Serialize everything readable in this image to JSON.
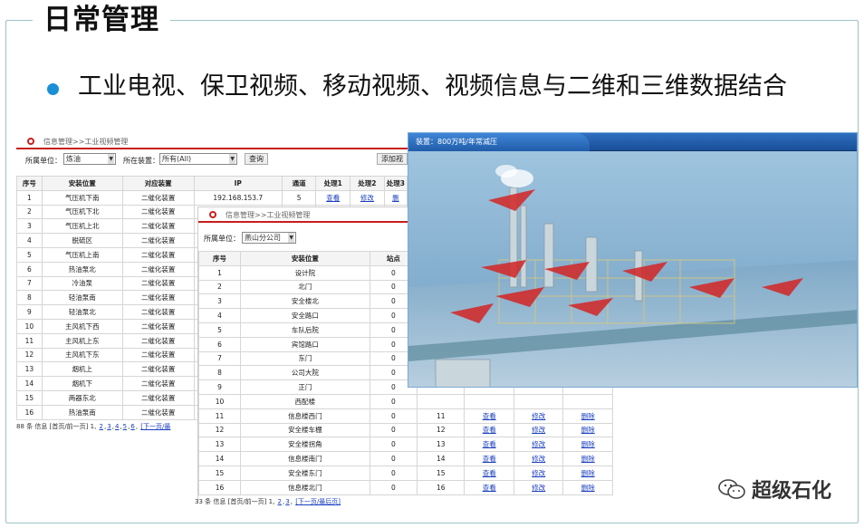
{
  "slide": {
    "title": "日常管理",
    "bullet_text": "工业电视、保卫视频、移动视频、视频信息与二维和三维数据结合"
  },
  "sheet1": {
    "breadcrumb": "信息管理>>工业视频管理",
    "filter_unit_label": "所属单位：",
    "filter_unit_value": "炼油",
    "filter_device_label": "所在装置：",
    "filter_device_value": "所有(All)",
    "query_button": "查询",
    "add_button": "添加视频",
    "columns": [
      "序号",
      "安装位置",
      "对应装置",
      "IP",
      "通道",
      "处理1",
      "处理2",
      "处理3"
    ],
    "ip_value": "192.168.153.7",
    "channel_value": "5",
    "action_view": "查看",
    "action_edit": "修改",
    "action_delete": "删",
    "rows": [
      {
        "no": "1",
        "loc": "气压机下南",
        "dev": "二催化装置"
      },
      {
        "no": "2",
        "loc": "气压机下北",
        "dev": "二催化装置"
      },
      {
        "no": "3",
        "loc": "气压机上北",
        "dev": "二催化装置"
      },
      {
        "no": "4",
        "loc": "脱硫区",
        "dev": "二催化装置"
      },
      {
        "no": "5",
        "loc": "气压机上南",
        "dev": "二催化装置"
      },
      {
        "no": "6",
        "loc": "热油泵北",
        "dev": "二催化装置"
      },
      {
        "no": "7",
        "loc": "冷油泵",
        "dev": "二催化装置"
      },
      {
        "no": "8",
        "loc": "轻油泵南",
        "dev": "二催化装置"
      },
      {
        "no": "9",
        "loc": "轻油泵北",
        "dev": "二催化装置"
      },
      {
        "no": "10",
        "loc": "主风机下西",
        "dev": "二催化装置"
      },
      {
        "no": "11",
        "loc": "主风机上东",
        "dev": "二催化装置"
      },
      {
        "no": "12",
        "loc": "主风机下东",
        "dev": "二催化装置"
      },
      {
        "no": "13",
        "loc": "烟机上",
        "dev": "二催化装置"
      },
      {
        "no": "14",
        "loc": "烟机下",
        "dev": "二催化装置"
      },
      {
        "no": "15",
        "loc": "两器东北",
        "dev": "二催化装置"
      },
      {
        "no": "16",
        "loc": "热油泵南",
        "dev": "二催化装置"
      }
    ],
    "pager_prefix": "88 条 信息 [首页/前一页] 1,",
    "pager_pages": [
      "2",
      "3",
      "4",
      "5",
      "6"
    ],
    "pager_next": "[下一页/最"
  },
  "sheet2": {
    "breadcrumb": "信息管理>>工业视频管理",
    "filter_unit_label": "所属单位：",
    "filter_unit_value": "燕山分公司",
    "columns": [
      "序号",
      "安装位置",
      "站点"
    ],
    "action_view": "查看",
    "action_edit": "修改",
    "action_delete": "删除",
    "rows": [
      {
        "no": "1",
        "loc": "设计院",
        "site": "0"
      },
      {
        "no": "2",
        "loc": "北门",
        "site": "0"
      },
      {
        "no": "3",
        "loc": "安全楼北",
        "site": "0"
      },
      {
        "no": "4",
        "loc": "安全路口",
        "site": "0"
      },
      {
        "no": "5",
        "loc": "车队后院",
        "site": "0"
      },
      {
        "no": "6",
        "loc": "宾馆路口",
        "site": "0"
      },
      {
        "no": "7",
        "loc": "东门",
        "site": "0"
      },
      {
        "no": "8",
        "loc": "公司大院",
        "site": "0"
      },
      {
        "no": "9",
        "loc": "正门",
        "site": "0"
      },
      {
        "no": "10",
        "loc": "西配楼",
        "site": "0"
      },
      {
        "no": "11",
        "loc": "信息楼西门",
        "site": "0",
        "ch": "11"
      },
      {
        "no": "12",
        "loc": "安全楼车棚",
        "site": "0",
        "ch": "12"
      },
      {
        "no": "13",
        "loc": "安全楼拐角",
        "site": "0",
        "ch": "13"
      },
      {
        "no": "14",
        "loc": "信息楼南门",
        "site": "0",
        "ch": "14"
      },
      {
        "no": "15",
        "loc": "安全楼东门",
        "site": "0",
        "ch": "15"
      },
      {
        "no": "16",
        "loc": "信息楼北门",
        "site": "0",
        "ch": "16"
      }
    ],
    "pager_prefix": "33 条 信息 [首页/前一页] 1,",
    "pager_pages": [
      "2",
      "3"
    ],
    "pager_next": "[下一页/最后页]"
  },
  "render": {
    "caption": "装置：800万吨/年常减压"
  },
  "watermark": {
    "text": "超级石化",
    "icon": "wechat-icon"
  },
  "colors": {
    "accent_red": "#c81e1e",
    "bullet_blue": "#1a8fd6",
    "link_blue": "#1a3fbf"
  }
}
